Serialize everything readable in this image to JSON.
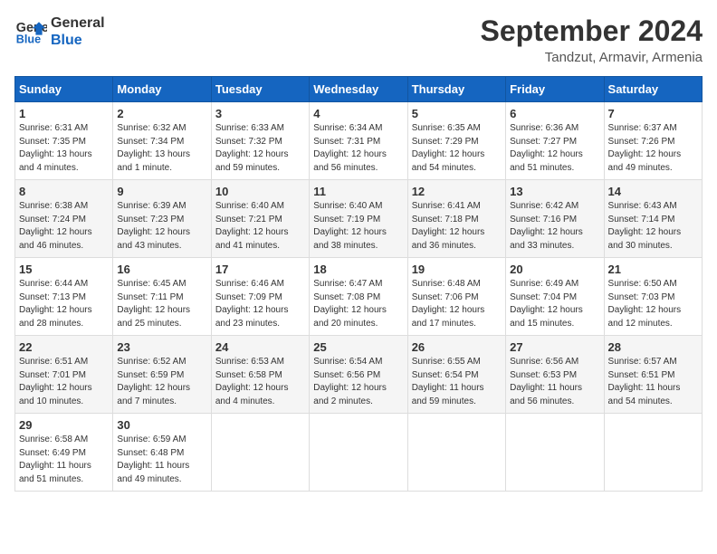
{
  "header": {
    "logo_line1": "General",
    "logo_line2": "Blue",
    "month_year": "September 2024",
    "location": "Tandzut, Armavir, Armenia"
  },
  "columns": [
    "Sunday",
    "Monday",
    "Tuesday",
    "Wednesday",
    "Thursday",
    "Friday",
    "Saturday"
  ],
  "rows": [
    [
      {
        "day": "1",
        "lines": [
          "Sunrise: 6:31 AM",
          "Sunset: 7:35 PM",
          "Daylight: 13 hours",
          "and 4 minutes."
        ]
      },
      {
        "day": "2",
        "lines": [
          "Sunrise: 6:32 AM",
          "Sunset: 7:34 PM",
          "Daylight: 13 hours",
          "and 1 minute."
        ]
      },
      {
        "day": "3",
        "lines": [
          "Sunrise: 6:33 AM",
          "Sunset: 7:32 PM",
          "Daylight: 12 hours",
          "and 59 minutes."
        ]
      },
      {
        "day": "4",
        "lines": [
          "Sunrise: 6:34 AM",
          "Sunset: 7:31 PM",
          "Daylight: 12 hours",
          "and 56 minutes."
        ]
      },
      {
        "day": "5",
        "lines": [
          "Sunrise: 6:35 AM",
          "Sunset: 7:29 PM",
          "Daylight: 12 hours",
          "and 54 minutes."
        ]
      },
      {
        "day": "6",
        "lines": [
          "Sunrise: 6:36 AM",
          "Sunset: 7:27 PM",
          "Daylight: 12 hours",
          "and 51 minutes."
        ]
      },
      {
        "day": "7",
        "lines": [
          "Sunrise: 6:37 AM",
          "Sunset: 7:26 PM",
          "Daylight: 12 hours",
          "and 49 minutes."
        ]
      }
    ],
    [
      {
        "day": "8",
        "lines": [
          "Sunrise: 6:38 AM",
          "Sunset: 7:24 PM",
          "Daylight: 12 hours",
          "and 46 minutes."
        ]
      },
      {
        "day": "9",
        "lines": [
          "Sunrise: 6:39 AM",
          "Sunset: 7:23 PM",
          "Daylight: 12 hours",
          "and 43 minutes."
        ]
      },
      {
        "day": "10",
        "lines": [
          "Sunrise: 6:40 AM",
          "Sunset: 7:21 PM",
          "Daylight: 12 hours",
          "and 41 minutes."
        ]
      },
      {
        "day": "11",
        "lines": [
          "Sunrise: 6:40 AM",
          "Sunset: 7:19 PM",
          "Daylight: 12 hours",
          "and 38 minutes."
        ]
      },
      {
        "day": "12",
        "lines": [
          "Sunrise: 6:41 AM",
          "Sunset: 7:18 PM",
          "Daylight: 12 hours",
          "and 36 minutes."
        ]
      },
      {
        "day": "13",
        "lines": [
          "Sunrise: 6:42 AM",
          "Sunset: 7:16 PM",
          "Daylight: 12 hours",
          "and 33 minutes."
        ]
      },
      {
        "day": "14",
        "lines": [
          "Sunrise: 6:43 AM",
          "Sunset: 7:14 PM",
          "Daylight: 12 hours",
          "and 30 minutes."
        ]
      }
    ],
    [
      {
        "day": "15",
        "lines": [
          "Sunrise: 6:44 AM",
          "Sunset: 7:13 PM",
          "Daylight: 12 hours",
          "and 28 minutes."
        ]
      },
      {
        "day": "16",
        "lines": [
          "Sunrise: 6:45 AM",
          "Sunset: 7:11 PM",
          "Daylight: 12 hours",
          "and 25 minutes."
        ]
      },
      {
        "day": "17",
        "lines": [
          "Sunrise: 6:46 AM",
          "Sunset: 7:09 PM",
          "Daylight: 12 hours",
          "and 23 minutes."
        ]
      },
      {
        "day": "18",
        "lines": [
          "Sunrise: 6:47 AM",
          "Sunset: 7:08 PM",
          "Daylight: 12 hours",
          "and 20 minutes."
        ]
      },
      {
        "day": "19",
        "lines": [
          "Sunrise: 6:48 AM",
          "Sunset: 7:06 PM",
          "Daylight: 12 hours",
          "and 17 minutes."
        ]
      },
      {
        "day": "20",
        "lines": [
          "Sunrise: 6:49 AM",
          "Sunset: 7:04 PM",
          "Daylight: 12 hours",
          "and 15 minutes."
        ]
      },
      {
        "day": "21",
        "lines": [
          "Sunrise: 6:50 AM",
          "Sunset: 7:03 PM",
          "Daylight: 12 hours",
          "and 12 minutes."
        ]
      }
    ],
    [
      {
        "day": "22",
        "lines": [
          "Sunrise: 6:51 AM",
          "Sunset: 7:01 PM",
          "Daylight: 12 hours",
          "and 10 minutes."
        ]
      },
      {
        "day": "23",
        "lines": [
          "Sunrise: 6:52 AM",
          "Sunset: 6:59 PM",
          "Daylight: 12 hours",
          "and 7 minutes."
        ]
      },
      {
        "day": "24",
        "lines": [
          "Sunrise: 6:53 AM",
          "Sunset: 6:58 PM",
          "Daylight: 12 hours",
          "and 4 minutes."
        ]
      },
      {
        "day": "25",
        "lines": [
          "Sunrise: 6:54 AM",
          "Sunset: 6:56 PM",
          "Daylight: 12 hours",
          "and 2 minutes."
        ]
      },
      {
        "day": "26",
        "lines": [
          "Sunrise: 6:55 AM",
          "Sunset: 6:54 PM",
          "Daylight: 11 hours",
          "and 59 minutes."
        ]
      },
      {
        "day": "27",
        "lines": [
          "Sunrise: 6:56 AM",
          "Sunset: 6:53 PM",
          "Daylight: 11 hours",
          "and 56 minutes."
        ]
      },
      {
        "day": "28",
        "lines": [
          "Sunrise: 6:57 AM",
          "Sunset: 6:51 PM",
          "Daylight: 11 hours",
          "and 54 minutes."
        ]
      }
    ],
    [
      {
        "day": "29",
        "lines": [
          "Sunrise: 6:58 AM",
          "Sunset: 6:49 PM",
          "Daylight: 11 hours",
          "and 51 minutes."
        ]
      },
      {
        "day": "30",
        "lines": [
          "Sunrise: 6:59 AM",
          "Sunset: 6:48 PM",
          "Daylight: 11 hours",
          "and 49 minutes."
        ]
      },
      null,
      null,
      null,
      null,
      null
    ]
  ]
}
